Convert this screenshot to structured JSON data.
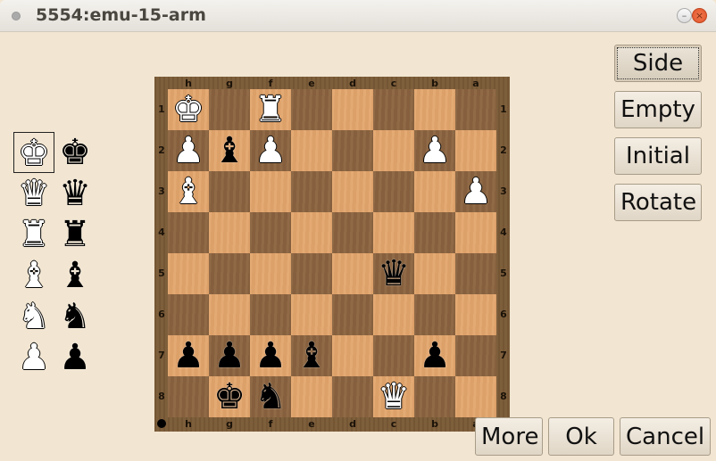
{
  "window": {
    "title": "5554:emu-15-arm",
    "controls": {
      "minimize": "minimize-icon",
      "close": "close-icon"
    }
  },
  "board": {
    "orientation": "flipped",
    "files_top": [
      "h",
      "g",
      "f",
      "e",
      "d",
      "c",
      "b",
      "a"
    ],
    "files_bottom": [
      "h",
      "g",
      "f",
      "e",
      "d",
      "c",
      "b",
      "a"
    ],
    "ranks": [
      "1",
      "2",
      "3",
      "4",
      "5",
      "6",
      "7",
      "8"
    ],
    "side_to_move": "black",
    "pieces": [
      {
        "square": "h1",
        "color": "white",
        "type": "king",
        "glyph": "♚"
      },
      {
        "square": "f1",
        "color": "white",
        "type": "rook",
        "glyph": "♜"
      },
      {
        "square": "h2",
        "color": "white",
        "type": "pawn",
        "glyph": "♟"
      },
      {
        "square": "g2",
        "color": "black",
        "type": "bishop",
        "glyph": "♝"
      },
      {
        "square": "f2",
        "color": "white",
        "type": "pawn",
        "glyph": "♟"
      },
      {
        "square": "b2",
        "color": "white",
        "type": "pawn",
        "glyph": "♟"
      },
      {
        "square": "h3",
        "color": "white",
        "type": "bishop",
        "glyph": "♝"
      },
      {
        "square": "a3",
        "color": "white",
        "type": "pawn",
        "glyph": "♟"
      },
      {
        "square": "c5",
        "color": "black",
        "type": "queen",
        "glyph": "♛"
      },
      {
        "square": "h7",
        "color": "black",
        "type": "pawn",
        "glyph": "♟"
      },
      {
        "square": "g7",
        "color": "black",
        "type": "pawn",
        "glyph": "♟"
      },
      {
        "square": "f7",
        "color": "black",
        "type": "pawn",
        "glyph": "♟"
      },
      {
        "square": "e7",
        "color": "black",
        "type": "bishop",
        "glyph": "♝"
      },
      {
        "square": "b7",
        "color": "black",
        "type": "pawn",
        "glyph": "♟"
      },
      {
        "square": "g8",
        "color": "black",
        "type": "king",
        "glyph": "♚"
      },
      {
        "square": "f8",
        "color": "black",
        "type": "knight",
        "glyph": "♞"
      },
      {
        "square": "c8",
        "color": "white",
        "type": "queen",
        "glyph": "♛"
      }
    ]
  },
  "palette": {
    "selected": "white-king",
    "rows": [
      {
        "type": "king",
        "glyph": "♚"
      },
      {
        "type": "queen",
        "glyph": "♛"
      },
      {
        "type": "rook",
        "glyph": "♜"
      },
      {
        "type": "bishop",
        "glyph": "♝"
      },
      {
        "type": "knight",
        "glyph": "♞"
      },
      {
        "type": "pawn",
        "glyph": "♟"
      }
    ]
  },
  "side_buttons": {
    "side": "Side",
    "empty": "Empty",
    "initial": "Initial",
    "rotate": "Rotate"
  },
  "bottom_buttons": {
    "more": "More",
    "ok": "Ok",
    "cancel": "Cancel"
  },
  "colors": {
    "light_square": "#e3a56c",
    "dark_square": "#8b6440",
    "frame": "#7a5a36",
    "background": "#f2e6d2"
  }
}
